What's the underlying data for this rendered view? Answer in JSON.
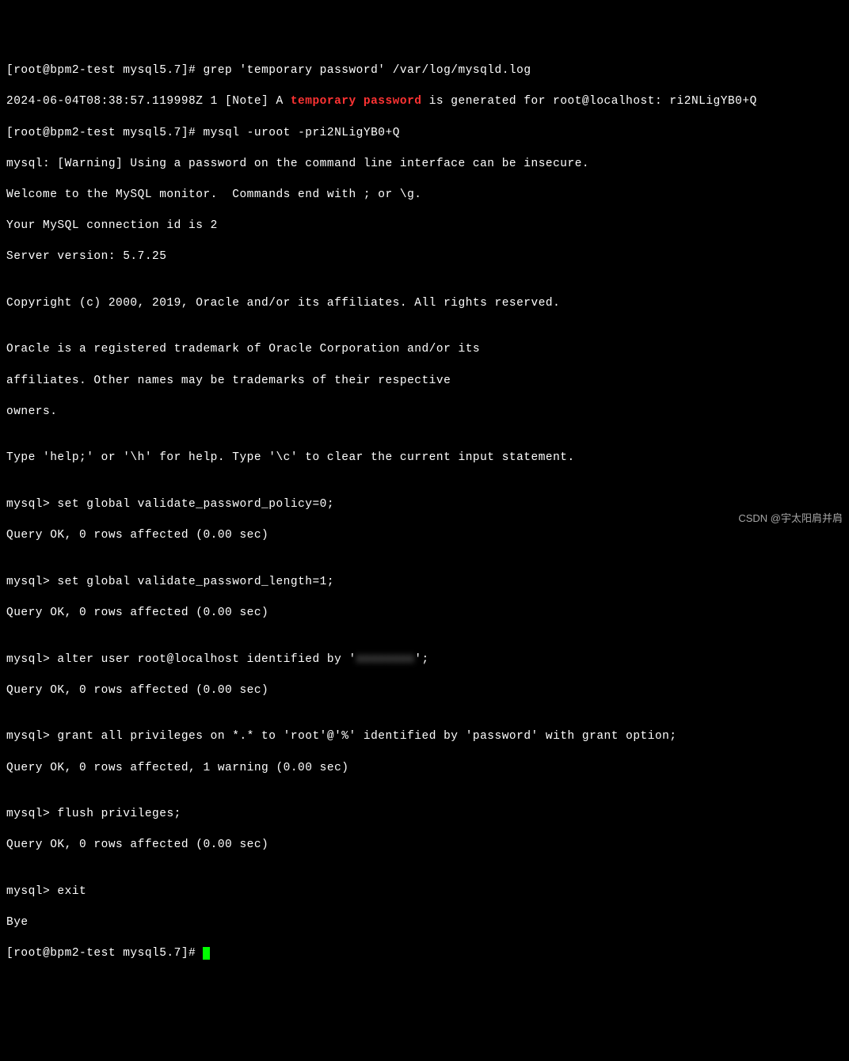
{
  "terminal": {
    "prompt1": "[root@bpm2-test mysql5.7]# ",
    "cmd1": "grep 'temporary password' /var/log/mysqld.log",
    "logline_pre": "2024-06-04T08:38:57.119998Z 1 [Note] A ",
    "logline_hl": "temporary password",
    "logline_post": " is generated for root@localhost: ri2NLigYB0+Q",
    "prompt2": "[root@bpm2-test mysql5.7]# ",
    "cmd2": "mysql -uroot -pri2NLigYB0+Q",
    "warn": "mysql: [Warning] Using a password on the command line interface can be insecure.",
    "welcome1": "Welcome to the MySQL monitor.  Commands end with ; or \\g.",
    "welcome2": "Your MySQL connection id is 2",
    "welcome3": "Server version: 5.7.25",
    "blank": "",
    "copyright": "Copyright (c) 2000, 2019, Oracle and/or its affiliates. All rights reserved.",
    "trademark1": "Oracle is a registered trademark of Oracle Corporation and/or its",
    "trademark2": "affiliates. Other names may be trademarks of their respective",
    "trademark3": "owners.",
    "help": "Type 'help;' or '\\h' for help. Type '\\c' to clear the current input statement.",
    "mysql_prompt": "mysql> ",
    "q1": "set global validate_password_policy=0;",
    "r1": "Query OK, 0 rows affected (0.00 sec)",
    "q2": "set global validate_password_length=1;",
    "r2": "Query OK, 0 rows affected (0.00 sec)",
    "q3_pre": "alter user root@localhost identified by '",
    "q3_blur": "xxxxxxxx",
    "q3_post": "';",
    "r3": "Query OK, 0 rows affected (0.00 sec)",
    "q4": "grant all privileges on *.* to 'root'@'%' identified by 'password' with grant option;",
    "r4": "Query OK, 0 rows affected, 1 warning (0.00 sec)",
    "q5": "flush privileges;",
    "r5": "Query OK, 0 rows affected (0.00 sec)",
    "q6": "exit",
    "bye": "Bye",
    "prompt3": "[root@bpm2-test mysql5.7]# "
  },
  "watermark": "CSDN @宇太阳肩并肩"
}
